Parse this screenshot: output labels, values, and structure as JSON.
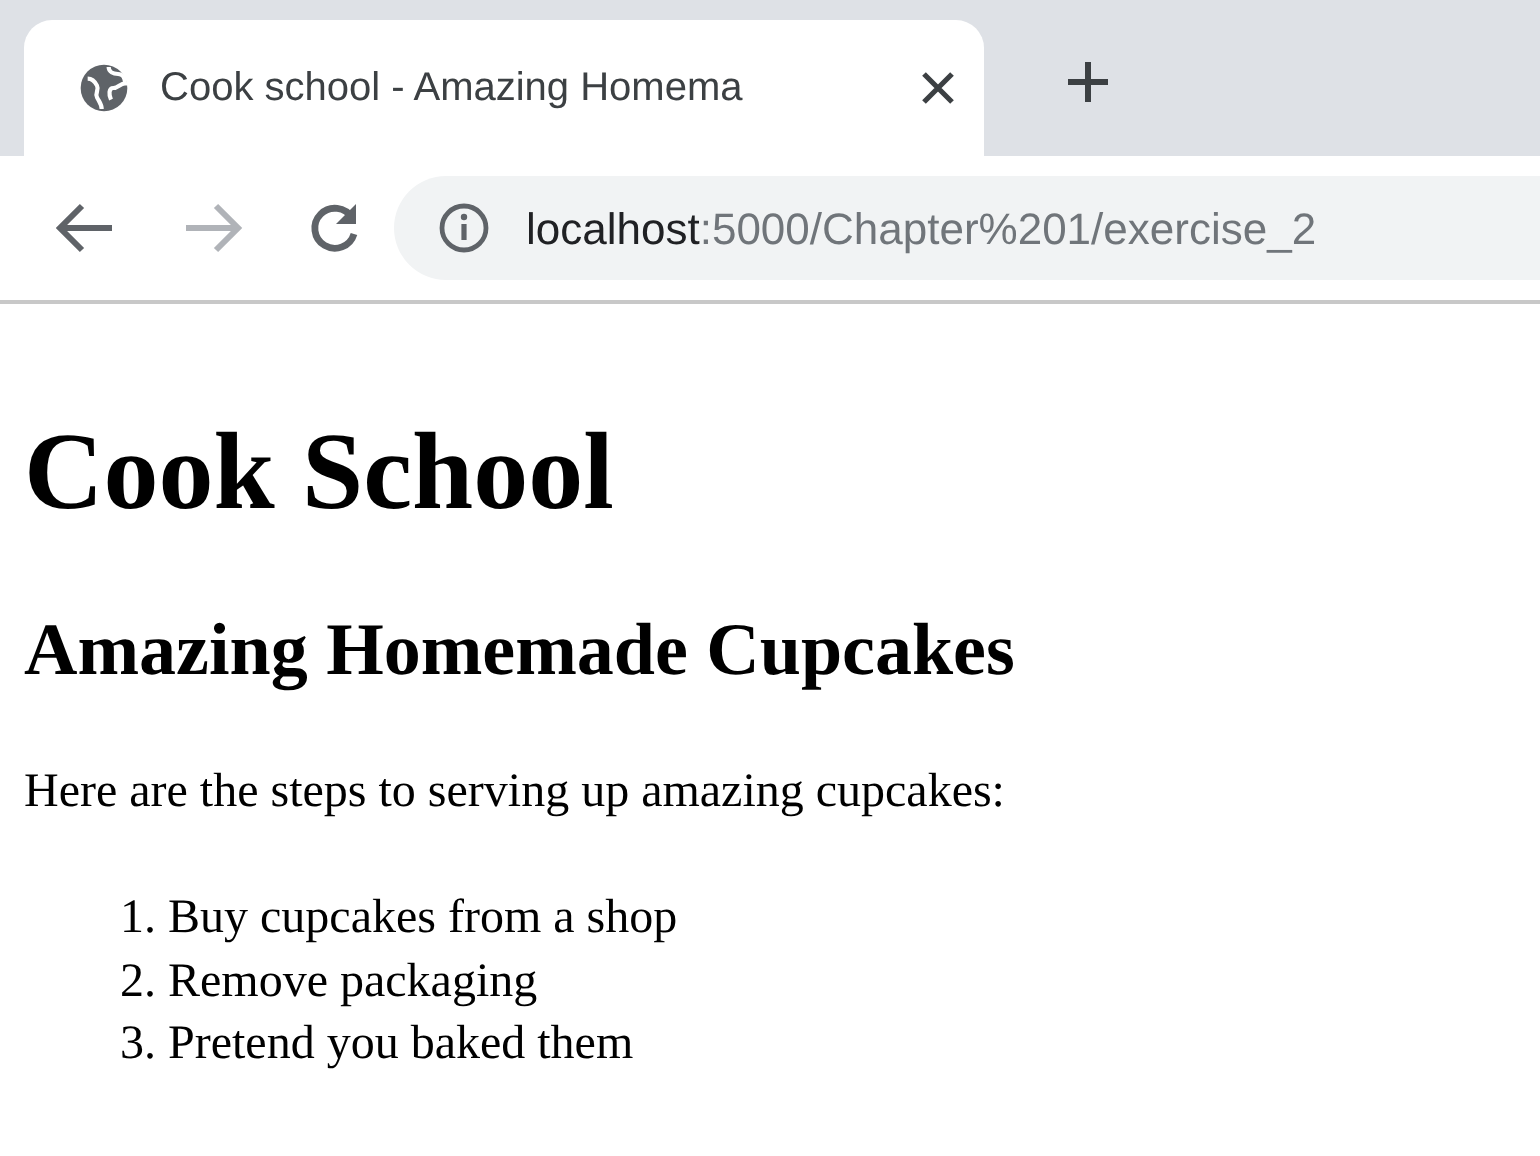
{
  "browser": {
    "tabs": [
      {
        "title": "Cook school - Amazing Homema",
        "selected": true
      }
    ],
    "toolbar": {
      "back": {
        "disabled": false
      },
      "forward": {
        "disabled": true
      },
      "address": {
        "host": "localhost",
        "path": ":5000/Chapter%201/exercise_2"
      }
    }
  },
  "page": {
    "heading": "Cook School",
    "subheading": "Amazing Homemade Cupcakes",
    "intro": "Here are the steps to serving up amazing cupcakes:",
    "steps": [
      {
        "number": "1.",
        "text": "Buy cupcakes from a shop"
      },
      {
        "number": "2.",
        "text": "Remove packaging"
      },
      {
        "number": "3.",
        "text": "Pretend you baked them"
      }
    ]
  }
}
